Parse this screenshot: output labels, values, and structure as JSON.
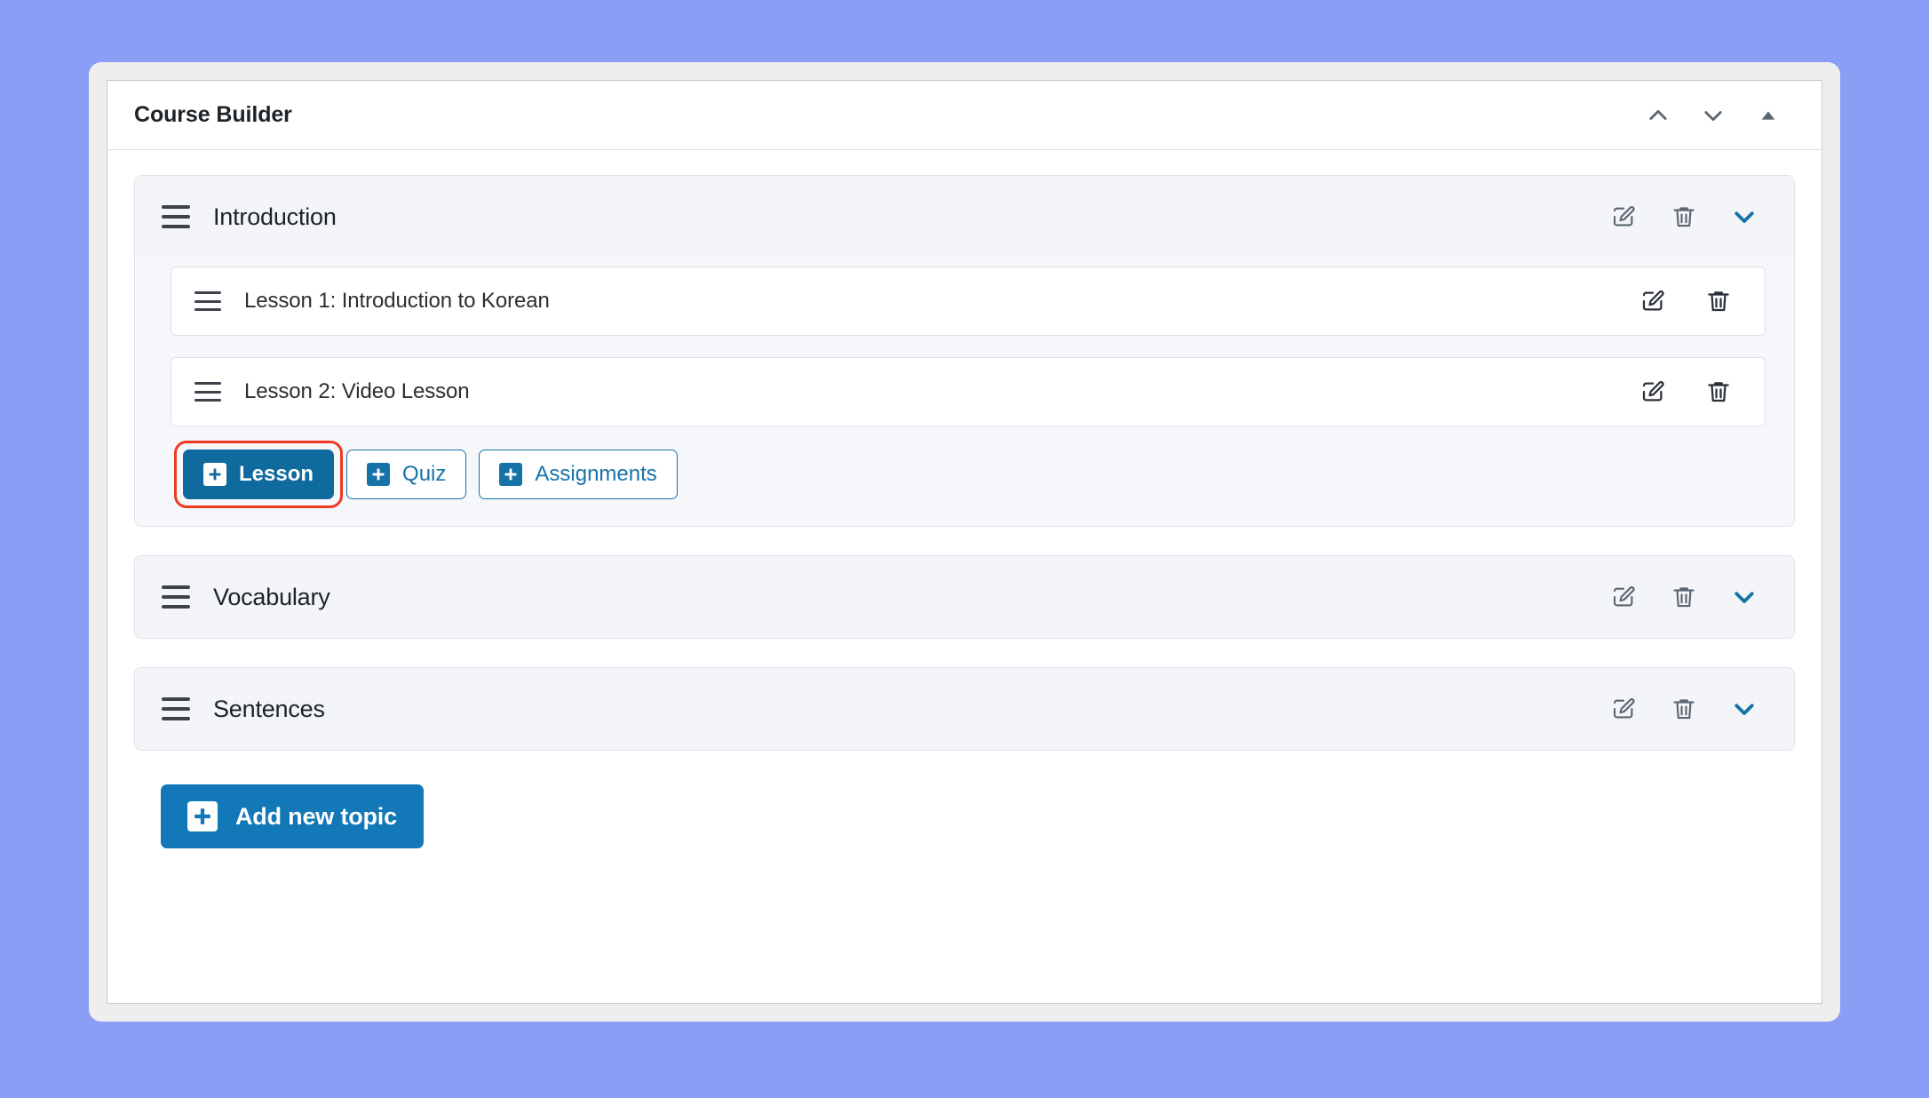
{
  "panel": {
    "title": "Course Builder",
    "header_icons": [
      {
        "name": "chevron-up-icon",
        "label": "Move up"
      },
      {
        "name": "chevron-down-icon",
        "label": "Move down"
      },
      {
        "name": "triangle-up-icon",
        "label": "Collapse panel"
      }
    ]
  },
  "topics": [
    {
      "title": "Introduction",
      "expanded": true,
      "drag_handle_label": "Reorder topic",
      "edit_label": "Edit topic",
      "delete_label": "Delete topic",
      "toggle_label": "Collapse topic",
      "lessons": [
        {
          "title": "Lesson 1: Introduction to Korean",
          "edit_label": "Edit lesson",
          "delete_label": "Delete lesson"
        },
        {
          "title": "Lesson 2: Video Lesson",
          "edit_label": "Edit lesson",
          "delete_label": "Delete lesson"
        }
      ],
      "add_buttons": [
        {
          "label": "Lesson",
          "style": "primary",
          "highlighted": true
        },
        {
          "label": "Quiz",
          "style": "outline",
          "highlighted": false
        },
        {
          "label": "Assignments",
          "style": "outline",
          "highlighted": false
        }
      ]
    },
    {
      "title": "Vocabulary",
      "expanded": false,
      "drag_handle_label": "Reorder topic",
      "edit_label": "Edit topic",
      "delete_label": "Delete topic",
      "toggle_label": "Expand topic"
    },
    {
      "title": "Sentences",
      "expanded": false,
      "drag_handle_label": "Reorder topic",
      "edit_label": "Edit topic",
      "delete_label": "Delete topic",
      "toggle_label": "Expand topic"
    }
  ],
  "footer": {
    "add_topic_label": "Add new topic"
  },
  "colors": {
    "page_background": "#8b9ef5",
    "frame": "#eeeeee",
    "card": "#ffffff",
    "topic_header": "#f3f5f9",
    "primary_blue": "#0f6a9e",
    "accent_blue": "#1673a8",
    "footer_blue": "#1278b8",
    "highlight_red": "#f03a21",
    "text_dark": "#1d2327",
    "icon_gray": "#5b6670"
  }
}
